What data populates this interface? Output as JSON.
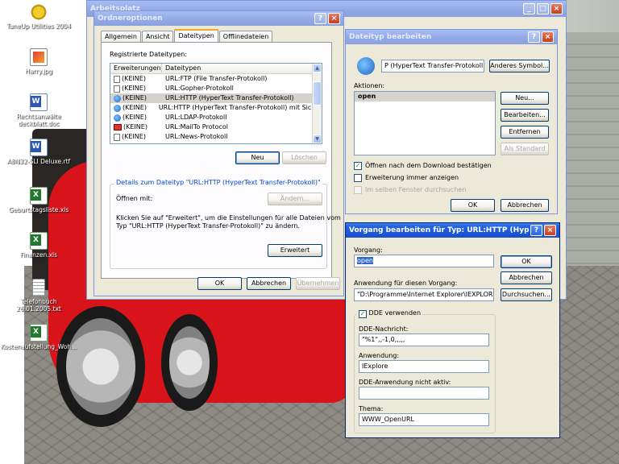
{
  "desktop": {
    "icons": [
      {
        "label": "TuneUp Utilities 2004",
        "icon": "tuneup-icon"
      },
      {
        "label": "Harry.jpg",
        "icon": "image-file-icon"
      },
      {
        "label": "Rechtsanwälte deckblatt.doc",
        "icon": "word-document-icon"
      },
      {
        "label": "A8N32-SLI Deluxe.rtf",
        "icon": "word-document-icon"
      },
      {
        "label": "Geburtstagsliste.xls",
        "icon": "excel-file-icon"
      },
      {
        "label": "Finanzen.xls",
        "icon": "excel-file-icon"
      },
      {
        "label": "Telefonbuch 26.01.2005.txt",
        "icon": "text-file-icon"
      },
      {
        "label": "Kostenaufstellung_Woh...",
        "icon": "excel-file-icon"
      }
    ],
    "background_title": "Arbeitsplatz"
  },
  "ordneroptionen": {
    "title": "Ordneroptionen",
    "tabs": [
      "Allgemein",
      "Ansicht",
      "Dateitypen",
      "Offlinedateien"
    ],
    "active_tab": "Dateitypen",
    "registered_label": "Registrierte Dateitypen:",
    "columns": [
      "Erweiterungen",
      "Dateitypen"
    ],
    "rows": [
      {
        "ext": "(KEINE)",
        "type": "URL:FTP (File Transfer-Protokoll)",
        "icon": "page"
      },
      {
        "ext": "(KEINE)",
        "type": "URL:Gopher-Protokoll",
        "icon": "page"
      },
      {
        "ext": "(KEINE)",
        "type": "URL:HTTP (HyperText Transfer-Protokoll)",
        "icon": "ie"
      },
      {
        "ext": "(KEINE)",
        "type": "URL:HTTP (HyperText Transfer-Protokoll) mit Sich...",
        "icon": "ie"
      },
      {
        "ext": "(KEINE)",
        "type": "URL:LDAP-Protokoll",
        "icon": "ie"
      },
      {
        "ext": "(KEINE)",
        "type": "URL:MailTo Protocol",
        "icon": "mail"
      },
      {
        "ext": "(KEINE)",
        "type": "URL:News-Protokoll",
        "icon": "page"
      }
    ],
    "selected_row": 2,
    "neu_button": "Neu",
    "loeschen_button": "Löschen",
    "details_title": "Details zum Dateityp \"URL:HTTP (HyperText Transfer-Protokoll)\"",
    "oeffnen_mit_label": "Öffnen mit:",
    "aendern_button": "Ändern...",
    "details_text_1": "Klicken Sie auf \"Erweitert\", um die Einstellungen für alle Dateien vom",
    "details_text_2": "Typ \"URL:HTTP (HyperText Transfer-Protokoll)\" zu ändern.",
    "erweitert_button": "Erweitert",
    "ok_button": "OK",
    "abbrechen_button": "Abbrechen",
    "uebernehmen_button": "Übernehmen"
  },
  "dateityp_bearbeiten": {
    "title": "Dateityp bearbeiten",
    "type_name": "P (HyperText Transfer-Protokoll)",
    "anderes_symbol_button": "Anderes Symbol...",
    "aktionen_label": "Aktionen:",
    "actions": [
      "open"
    ],
    "neu_button": "Neu...",
    "bearbeiten_button": "Bearbeiten...",
    "entfernen_button": "Entfernen",
    "als_standard_button": "Als Standard",
    "chk_oeffnen": {
      "label": "Öffnen nach dem Download bestätigen",
      "checked": true
    },
    "chk_erweiterung": {
      "label": "Erweiterung immer anzeigen",
      "checked": false
    },
    "chk_selben": {
      "label": "Im selben Fenster durchsuchen",
      "checked": false
    },
    "ok_button": "OK",
    "abbrechen_button": "Abbrechen"
  },
  "vorgang_bearbeiten": {
    "title": "Vorgang bearbeiten für Typ: URL:HTTP (Hype...",
    "vorgang_label": "Vorgang:",
    "vorgang_value": "open",
    "ok_button": "OK",
    "abbrechen_button": "Abbrechen",
    "anwendung_label": "Anwendung für diesen Vorgang:",
    "anwendung_value": "\"D:\\Programme\\Internet Explorer\\IEXPLORE.E",
    "durchsuchen_button": "Durchsuchen...",
    "dde_checkbox": {
      "label": "DDE verwenden",
      "checked": true
    },
    "dde_nachricht_label": "DDE-Nachricht:",
    "dde_nachricht_value": "\"%1\",,-1,0,,,,,",
    "anwendung2_label": "Anwendung:",
    "anwendung2_value": "IExplore",
    "dde_nicht_aktiv_label": "DDE-Anwendung nicht aktiv:",
    "dde_nicht_aktiv_value": "",
    "thema_label": "Thema:",
    "thema_value": "WWW_OpenURL"
  }
}
